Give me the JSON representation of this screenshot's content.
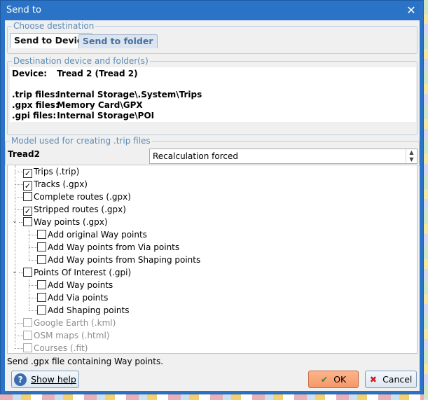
{
  "window": {
    "title": "Send to",
    "close_glyph": "✕"
  },
  "destination": {
    "legend": "Choose destination",
    "tabs": [
      {
        "label": "Send to Device",
        "active": true
      },
      {
        "label": "Send to folder",
        "active": false
      }
    ]
  },
  "device_info": {
    "legend": "Destination device and folder(s)",
    "rows": [
      {
        "label": "Device:",
        "value": "Tread 2 (Tread 2)"
      },
      {
        "label": ".trip files:",
        "value": "Internal Storage\\.System\\Trips"
      },
      {
        "label": ".gpx files:",
        "value": "Memory Card\\GPX"
      },
      {
        "label": ".gpi files:",
        "value": "Internal Storage\\POI"
      }
    ]
  },
  "model": {
    "legend": "Model used for creating .trip files",
    "name": "Tread2",
    "recalc_selected": "Recalculation forced"
  },
  "tree": {
    "items": [
      {
        "label": "Trips (.trip)",
        "checked": true,
        "disabled": false
      },
      {
        "label": "Tracks (.gpx)",
        "checked": true,
        "disabled": false
      },
      {
        "label": "Complete routes (.gpx)",
        "checked": false,
        "disabled": false
      },
      {
        "label": "Stripped routes (.gpx)",
        "checked": true,
        "disabled": false
      },
      {
        "label": "Way points (.gpx)",
        "checked": false,
        "disabled": false
      },
      {
        "label": "Add original Way points",
        "checked": false,
        "disabled": false
      },
      {
        "label": "Add Way points from Via points",
        "checked": false,
        "disabled": false
      },
      {
        "label": "Add Way points from Shaping points",
        "checked": false,
        "disabled": false
      },
      {
        "label": "Points Of Interest (.gpi)",
        "checked": false,
        "disabled": false
      },
      {
        "label": "Add Way points",
        "checked": false,
        "disabled": false
      },
      {
        "label": "Add Via points",
        "checked": false,
        "disabled": false
      },
      {
        "label": "Add Shaping points",
        "checked": false,
        "disabled": false
      },
      {
        "label": "Google Earth (.kml)",
        "checked": false,
        "disabled": true
      },
      {
        "label": "OSM maps (.html)",
        "checked": false,
        "disabled": true
      },
      {
        "label": "Courses (.fit)",
        "checked": false,
        "disabled": true
      }
    ]
  },
  "status_text": "Send .gpx file containing Way points.",
  "buttons": {
    "help": "Show help",
    "ok": "OK",
    "cancel": "Cancel"
  },
  "icons": {
    "help": "help-icon",
    "ok": "checkmark-icon",
    "cancel": "cross-icon"
  },
  "colors": {
    "title_bar": "#2b73c6",
    "legend_text": "#5d8ab5",
    "ok_button": "#f39868",
    "cancel_cross": "#d02020",
    "ok_check": "#2b8a3e"
  }
}
